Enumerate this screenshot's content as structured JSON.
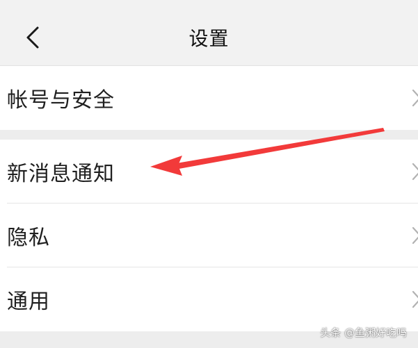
{
  "nav": {
    "title": "设置",
    "back_icon": "chevron-left-icon"
  },
  "groups": [
    {
      "items": [
        {
          "label": "帐号与安全",
          "icon": "chevron-right-icon"
        }
      ]
    },
    {
      "items": [
        {
          "label": "新消息通知",
          "icon": "chevron-right-icon"
        },
        {
          "label": "隐私",
          "icon": "chevron-right-icon"
        },
        {
          "label": "通用",
          "icon": "chevron-right-icon"
        }
      ]
    }
  ],
  "annotation": {
    "arrow_color": "#f23a3a",
    "points_to": "新消息通知"
  },
  "watermark": "头条 @鱼粥好吃吗",
  "colors": {
    "background": "#ededed",
    "nav_background": "#f2f2f2",
    "cell_background": "#ffffff",
    "divider": "#e6e6e6",
    "text": "#1f1f1f",
    "chevron": "#b2b2b2"
  }
}
